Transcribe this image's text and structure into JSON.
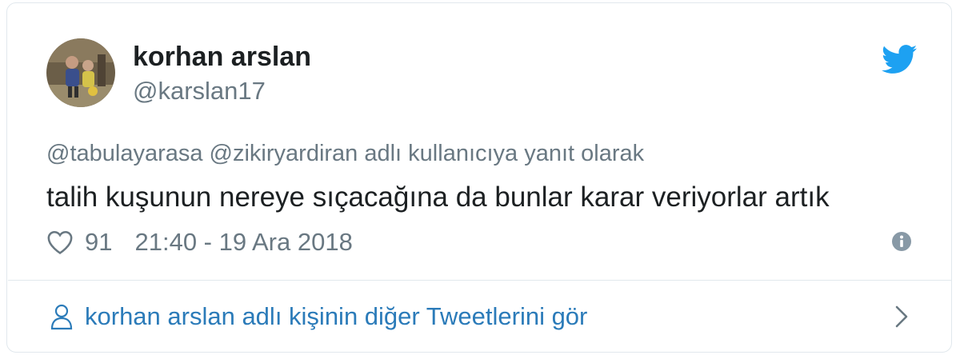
{
  "tweet": {
    "author_name": "korhan arslan",
    "author_handle": "@karslan17",
    "reply_context": "@tabulayarasa @zikiryardiran adlı kullanıcıya yanıt olarak",
    "text": "talih kuşunun nereye sıçacağına da bunlar karar veriyorlar artık",
    "likes": "91",
    "timestamp": "21:40 - 19 Ara 2018"
  },
  "footer": {
    "more_tweets_label": "korhan arslan adlı kişinin diğer Tweetlerini gör"
  },
  "icons": {
    "brand": "twitter-bird-icon",
    "like": "heart-icon",
    "info": "info-icon",
    "profile": "person-icon",
    "next": "chevron-right-icon"
  },
  "colors": {
    "twitter_blue": "#1da1f2",
    "link_blue": "#2b7bb9",
    "text": "#1c2022",
    "muted": "#697882",
    "border": "#e1e8ed"
  }
}
